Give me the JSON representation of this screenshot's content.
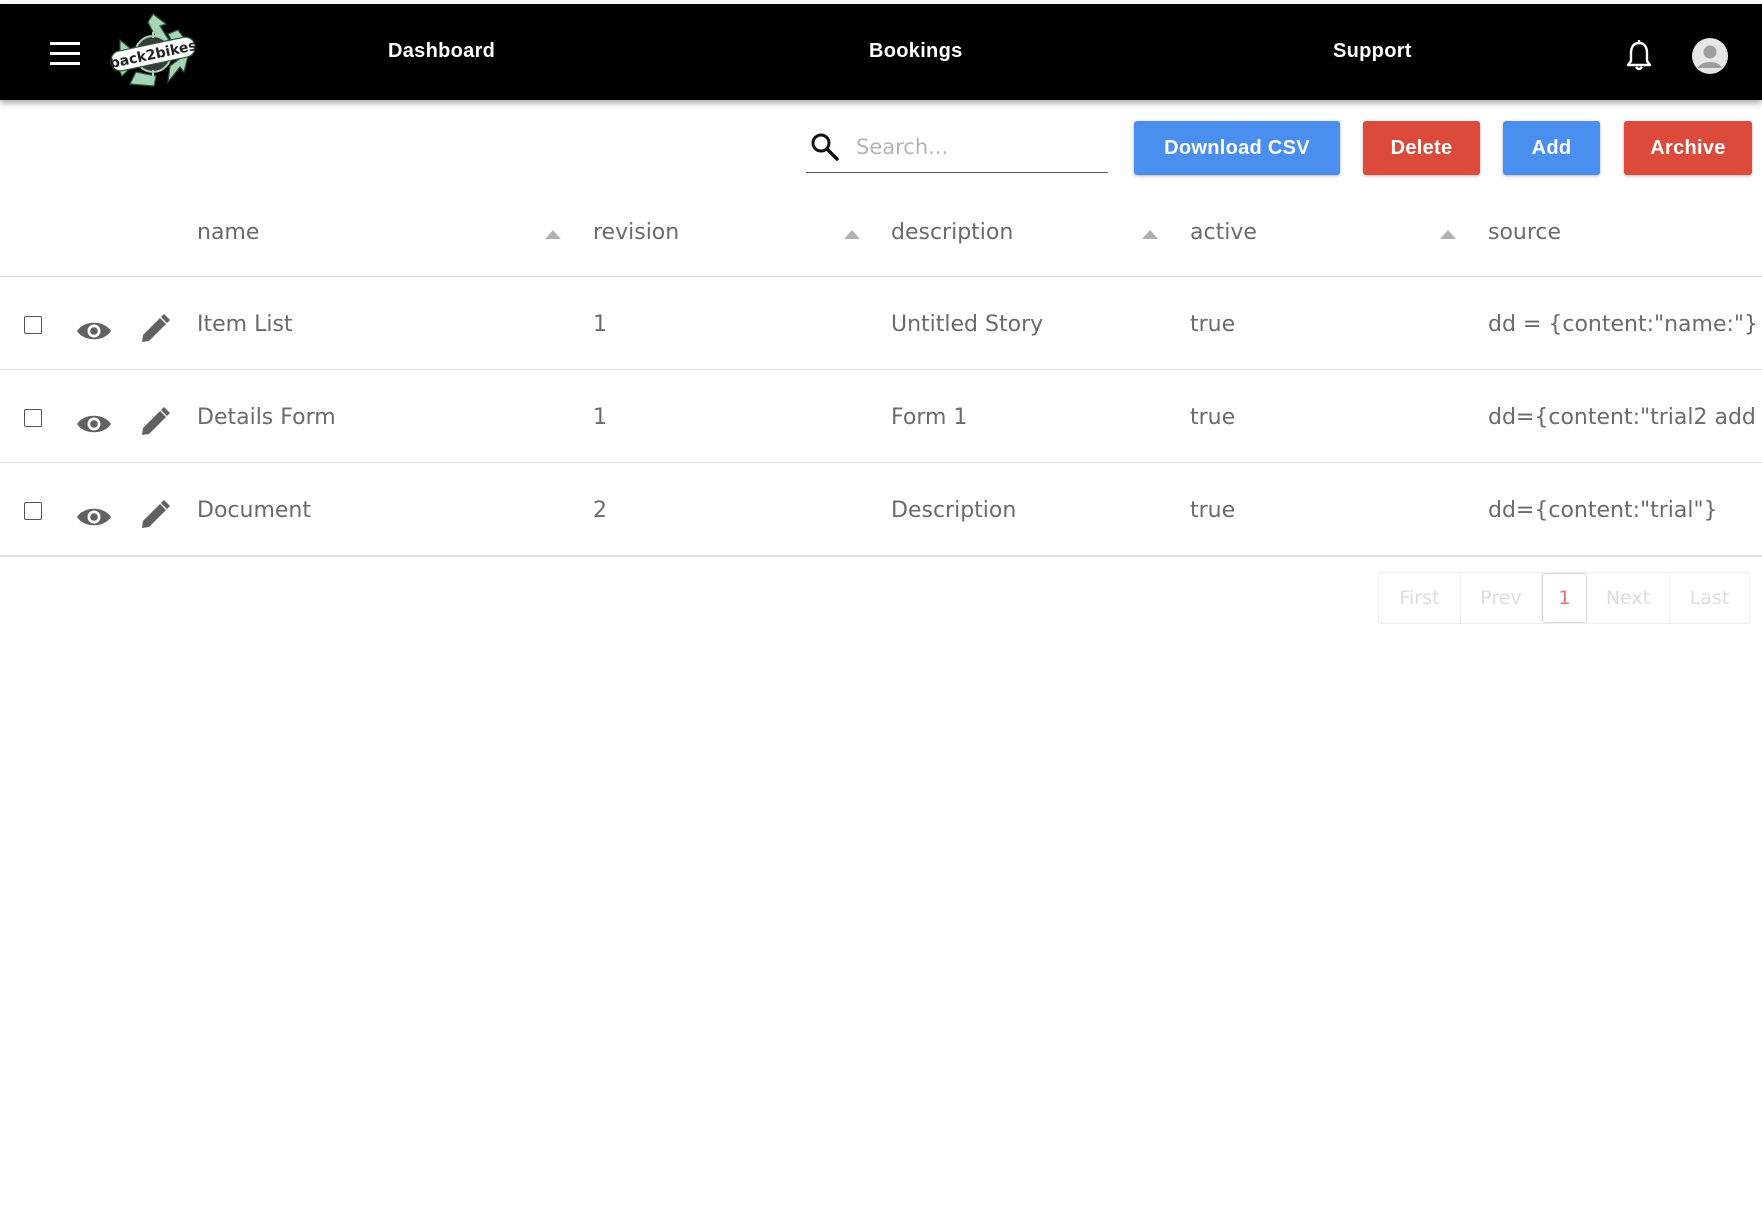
{
  "app": {
    "logo_text": "back2bikes"
  },
  "nav": {
    "items": [
      "Dashboard",
      "Bookings",
      "Support"
    ]
  },
  "toolbar": {
    "search_placeholder": "Search...",
    "download_csv": "Download CSV",
    "delete": "Delete",
    "add": "Add",
    "archive": "Archive"
  },
  "table": {
    "columns": [
      "name",
      "revision",
      "description",
      "active",
      "source"
    ],
    "rows": [
      {
        "name": "Item List",
        "revision": "1",
        "description": "Untitled Story",
        "active": "true",
        "source": "dd = {content:\"name:\"}"
      },
      {
        "name": "Details Form",
        "revision": "1",
        "description": "Form 1",
        "active": "true",
        "source": "dd={content:\"trial2 add"
      },
      {
        "name": "Document",
        "revision": "2",
        "description": "Description",
        "active": "true",
        "source": "dd={content:\"trial\"}"
      }
    ]
  },
  "pagination": {
    "first": "First",
    "prev": "Prev",
    "current": "1",
    "next": "Next",
    "last": "Last"
  },
  "colors": {
    "navbar": "#000000",
    "primary_blue": "#4a8ef0",
    "danger_red": "#dc4a3c",
    "logo_green": "#a8d5b5",
    "active_page": "#e57373"
  },
  "icons": [
    "menu-icon",
    "recycle-logo",
    "bell-icon",
    "user-avatar-icon",
    "search-icon",
    "eye-icon",
    "pencil-icon",
    "sort-up-icon"
  ]
}
